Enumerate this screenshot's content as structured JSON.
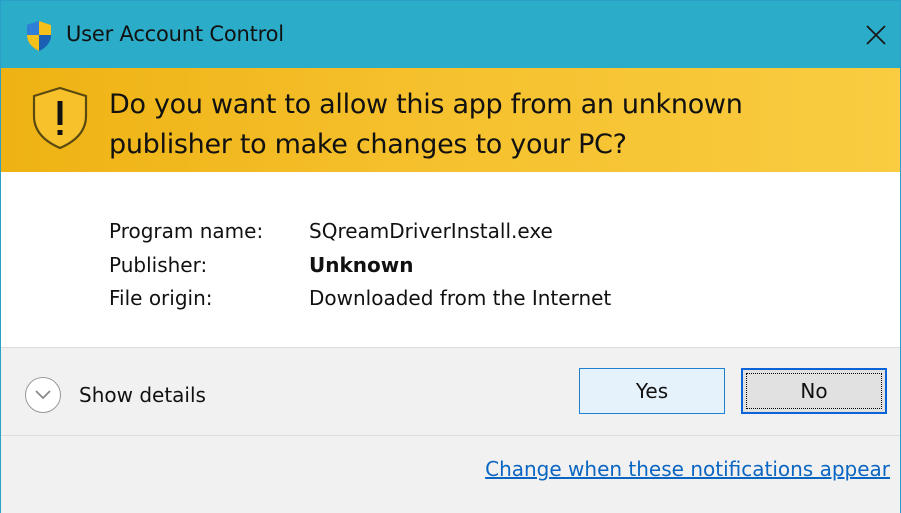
{
  "window": {
    "title": "User Account Control"
  },
  "banner": {
    "question": "Do you want to allow this app from an unknown publisher to make changes to your PC?"
  },
  "info": {
    "rows": [
      {
        "label": "Program name:",
        "value": "SQreamDriverInstall.exe"
      },
      {
        "label": "Publisher:",
        "value": "Unknown"
      },
      {
        "label": "File origin:",
        "value": "Downloaded from the Internet"
      }
    ]
  },
  "footer": {
    "show_details_label": "Show details",
    "yes_label": "Yes",
    "no_label": "No",
    "change_link": "Change when these notifications appear"
  },
  "icons": {
    "title": "shield-icon",
    "banner": "warning-shield-icon",
    "close": "close-icon",
    "details": "chevron-down-icon"
  },
  "colors": {
    "titlebar": "#2bacc9",
    "banner": "#f5c02c",
    "link": "#0a66c2"
  }
}
